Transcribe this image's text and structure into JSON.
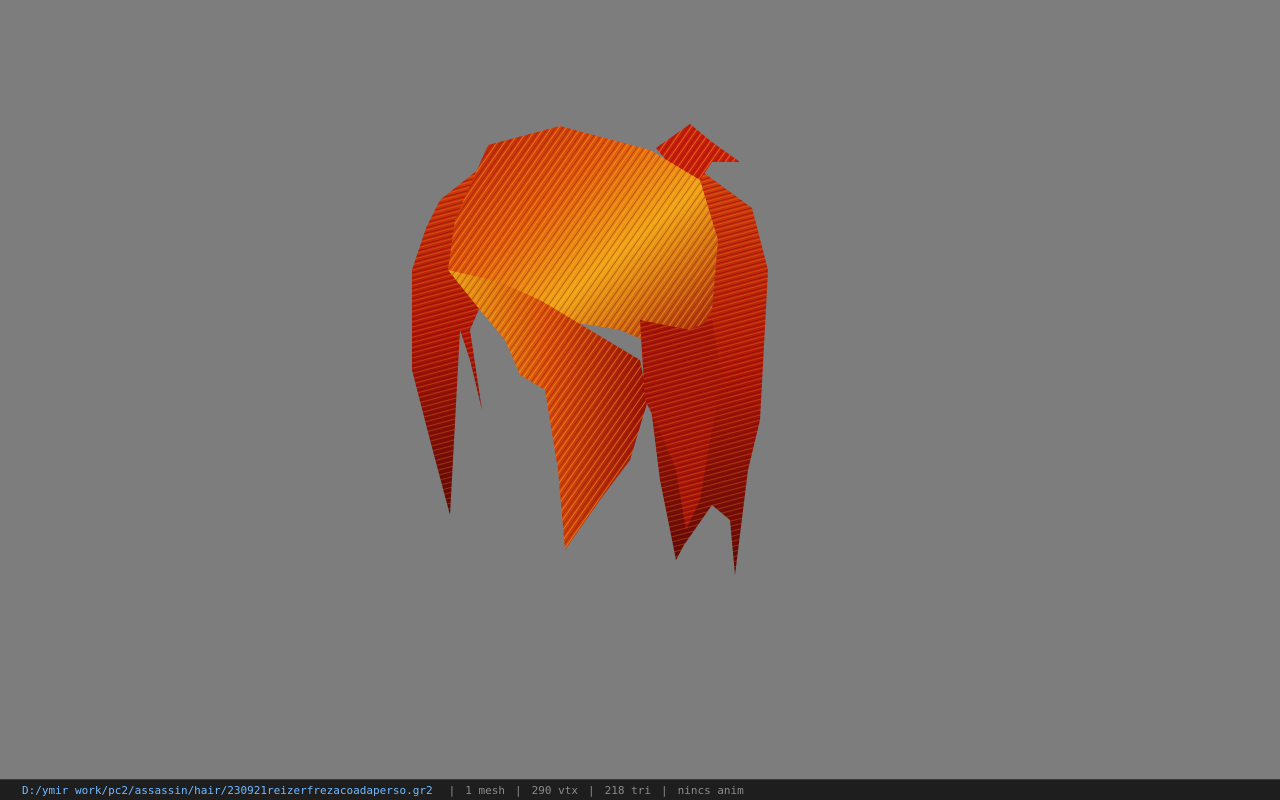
{
  "viewport": {
    "background_color": "#7d7d7d",
    "model": {
      "type": "hair-mesh",
      "primary_color": "#c41a0a",
      "highlight_color": "#f0a010",
      "shadow_color": "#5a0a08"
    }
  },
  "statusbar": {
    "file_path": "D:/ymir work/pc2/assassin/hair/230921reizerfrezacoadaperso.gr2",
    "separator": "|",
    "mesh_count": "1 mesh",
    "vertex_count": "290 vtx",
    "triangle_count": "218 tri",
    "animation": "nincs anim",
    "path_color": "#6fb8ff",
    "text_color": "#8a8a8a"
  }
}
